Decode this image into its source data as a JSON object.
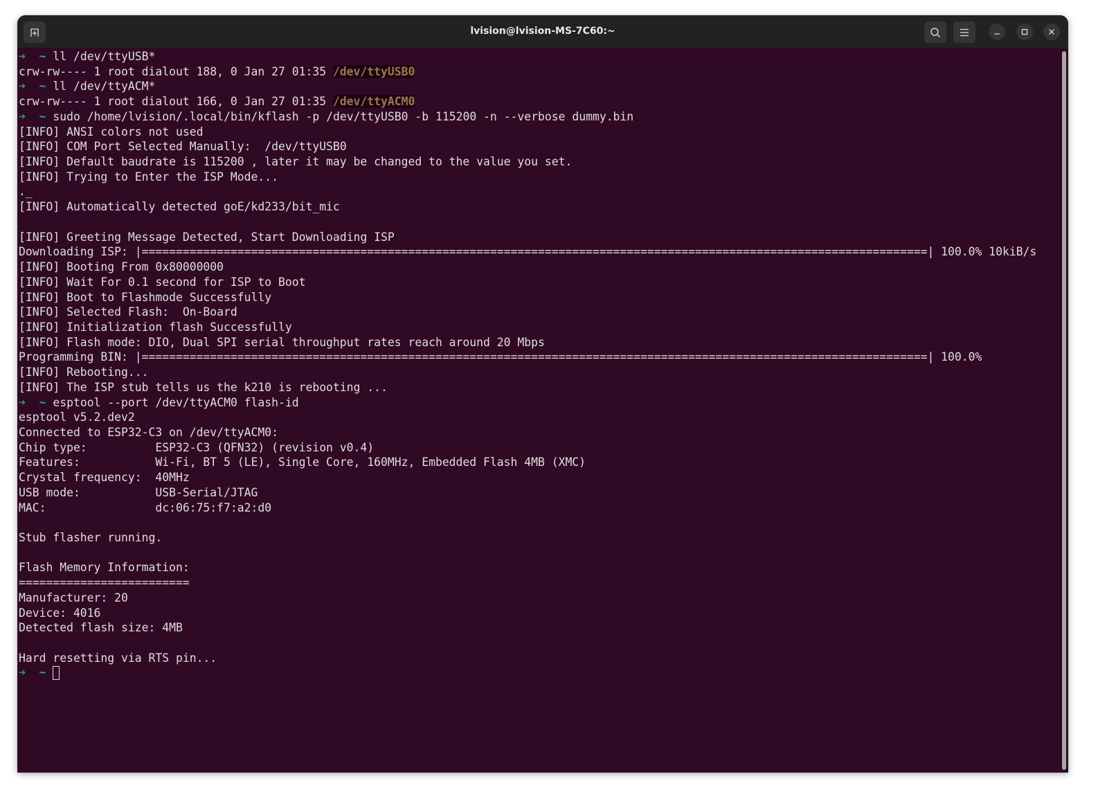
{
  "window": {
    "title": "lvision@lvision-MS-7C60:~"
  },
  "icons": {
    "new_tab": "new-tab-icon",
    "search": "search-icon",
    "menu": "hamburger-menu-icon",
    "minimize": "minimize-icon",
    "maximize": "maximize-icon",
    "close": "close-icon"
  },
  "colors": {
    "background": "#300a24",
    "prompt_arrow": "#26a269",
    "prompt_dir": "#2aa1b3",
    "highlight": "#a2734c"
  },
  "prompt": {
    "arrow": "➜",
    "dir": "~"
  },
  "terminal": {
    "lines": [
      {
        "prompt": true,
        "text": "ll /dev/ttyUSB*"
      },
      {
        "text": "crw-rw---- 1 root dialout 188, 0 Jan 27 01:35 ",
        "hl": "/dev/ttyUSB0"
      },
      {
        "prompt": true,
        "text": "ll /dev/ttyACM*"
      },
      {
        "text": "crw-rw---- 1 root dialout 166, 0 Jan 27 01:35 ",
        "hl": "/dev/ttyACM0"
      },
      {
        "prompt": true,
        "text": "sudo /home/lvision/.local/bin/kflash -p /dev/ttyUSB0 -b 115200 -n --verbose dummy.bin"
      },
      {
        "text": "[INFO] ANSI colors not used"
      },
      {
        "text": "[INFO] COM Port Selected Manually:  /dev/ttyUSB0"
      },
      {
        "text": "[INFO] Default baudrate is 115200 , later it may be changed to the value you set."
      },
      {
        "text": "[INFO] Trying to Enter the ISP Mode..."
      },
      {
        "text": "._"
      },
      {
        "text": "[INFO] Automatically detected goE/kd233/bit_mic"
      },
      {
        "text": ""
      },
      {
        "text": "[INFO] Greeting Message Detected, Start Downloading ISP"
      },
      {
        "text": "Downloading ISP: |===================================================================================================================| 100.0% 10kiB/s"
      },
      {
        "text": "[INFO] Booting From 0x80000000"
      },
      {
        "text": "[INFO] Wait For 0.1 second for ISP to Boot"
      },
      {
        "text": "[INFO] Boot to Flashmode Successfully"
      },
      {
        "text": "[INFO] Selected Flash:  On-Board"
      },
      {
        "text": "[INFO] Initialization flash Successfully"
      },
      {
        "text": "[INFO] Flash mode: DIO, Dual SPI serial throughput rates reach around 20 Mbps"
      },
      {
        "text": "Programming BIN: |===================================================================================================================| 100.0%"
      },
      {
        "text": "[INFO] Rebooting..."
      },
      {
        "text": "[INFO] The ISP stub tells us the k210 is rebooting ..."
      },
      {
        "prompt": true,
        "text": "esptool --port /dev/ttyACM0 flash-id"
      },
      {
        "text": "esptool v5.2.dev2"
      },
      {
        "text": "Connected to ESP32-C3 on /dev/ttyACM0:"
      },
      {
        "text": "Chip type:          ESP32-C3 (QFN32) (revision v0.4)"
      },
      {
        "text": "Features:           Wi-Fi, BT 5 (LE), Single Core, 160MHz, Embedded Flash 4MB (XMC)"
      },
      {
        "text": "Crystal frequency:  40MHz"
      },
      {
        "text": "USB mode:           USB-Serial/JTAG"
      },
      {
        "text": "MAC:                dc:06:75:f7:a2:d0"
      },
      {
        "text": ""
      },
      {
        "text": "Stub flasher running."
      },
      {
        "text": ""
      },
      {
        "text": "Flash Memory Information:"
      },
      {
        "text": "========================="
      },
      {
        "text": "Manufacturer: 20"
      },
      {
        "text": "Device: 4016"
      },
      {
        "text": "Detected flash size: 4MB"
      },
      {
        "text": ""
      },
      {
        "text": "Hard resetting via RTS pin..."
      },
      {
        "prompt": true,
        "text": "",
        "cursor": true
      }
    ]
  }
}
